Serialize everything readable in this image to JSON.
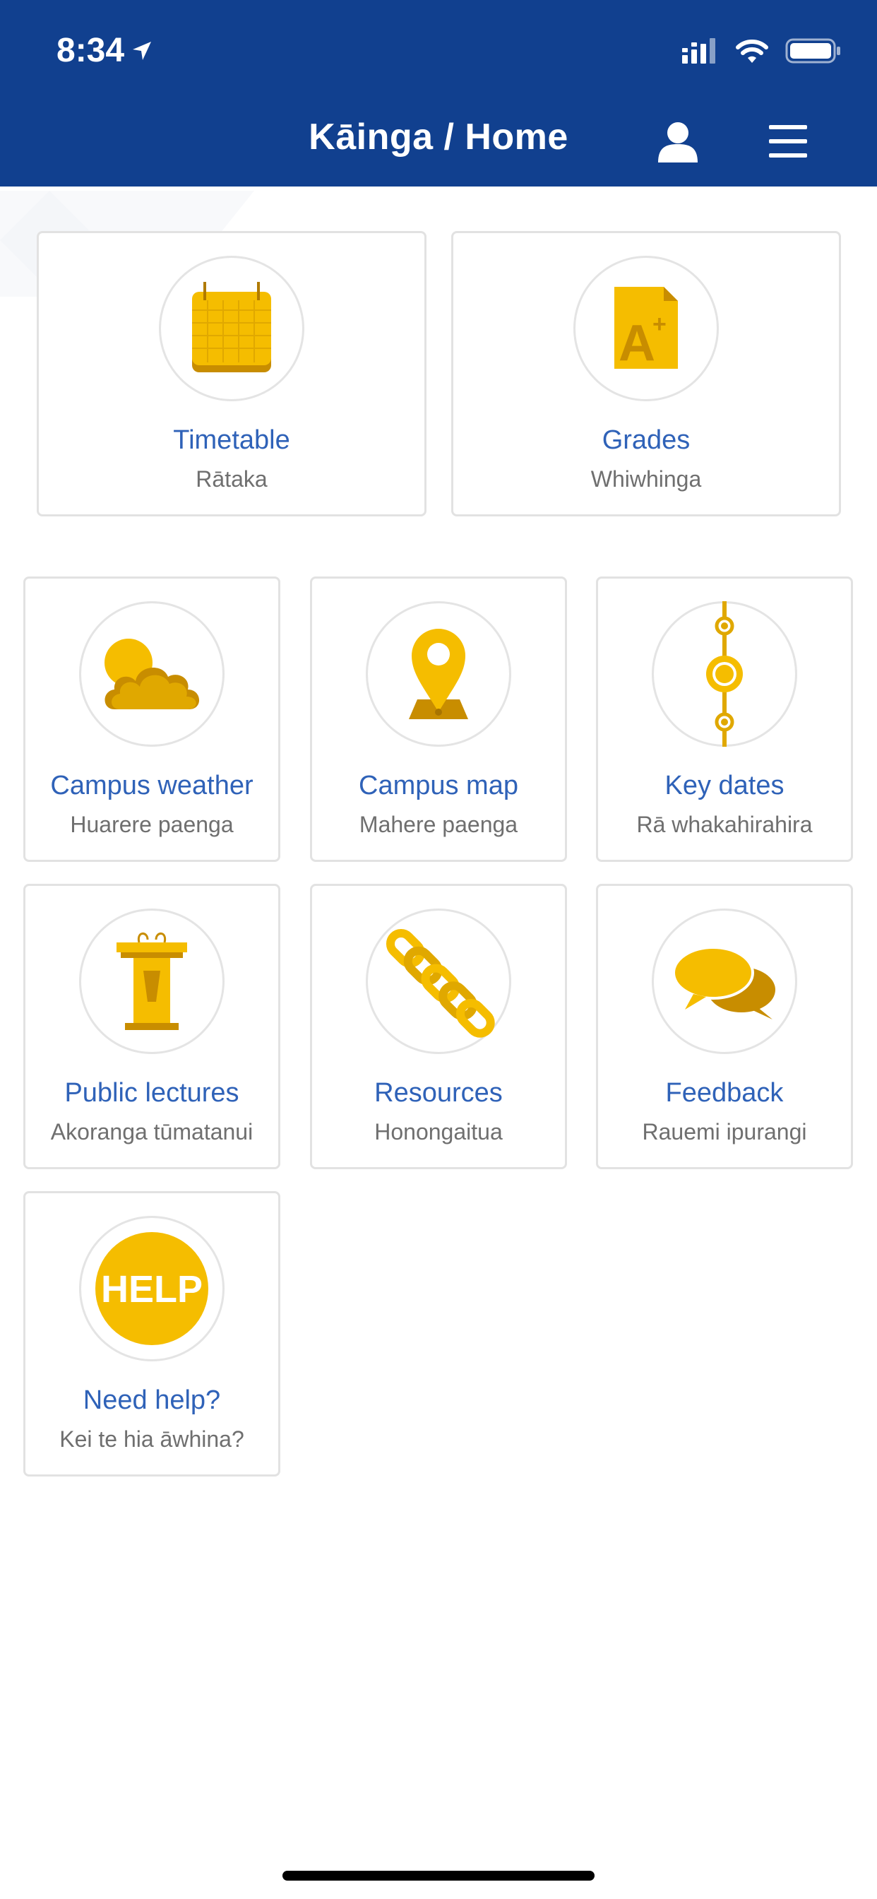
{
  "status_bar": {
    "time": "8:34"
  },
  "header": {
    "title": "Kāinga / Home",
    "user_icon": "user-icon",
    "menu_icon": "hamburger-menu-icon"
  },
  "colors": {
    "header": "#11408f",
    "accent": "#f5bd00",
    "label": "#2f62b8",
    "sub": "#6f6f6f"
  },
  "tiles": [
    {
      "label": "Timetable",
      "sub": "Rātaka",
      "icon": "calendar-icon"
    },
    {
      "label": "Grades",
      "sub": "Whiwhinga",
      "icon": "grade-document-icon"
    },
    {
      "label": "Campus weather",
      "sub": "Huarere paenga",
      "icon": "weather-icon"
    },
    {
      "label": "Campus map",
      "sub": "Mahere paenga",
      "icon": "map-pin-icon"
    },
    {
      "label": "Key dates",
      "sub": "Rā whakahirahira",
      "icon": "timeline-icon"
    },
    {
      "label": "Public lectures",
      "sub": "Akoranga tūmatanui",
      "icon": "lectern-icon"
    },
    {
      "label": "Resources",
      "sub": "Honongaitua",
      "icon": "chain-link-icon"
    },
    {
      "label": "Feedback",
      "sub": "Rauemi ipurangi",
      "icon": "chat-bubbles-icon"
    },
    {
      "label": "Need help?",
      "sub": "Kei te hia āwhina?",
      "icon": "help-icon",
      "icon_text": "HELP"
    }
  ]
}
